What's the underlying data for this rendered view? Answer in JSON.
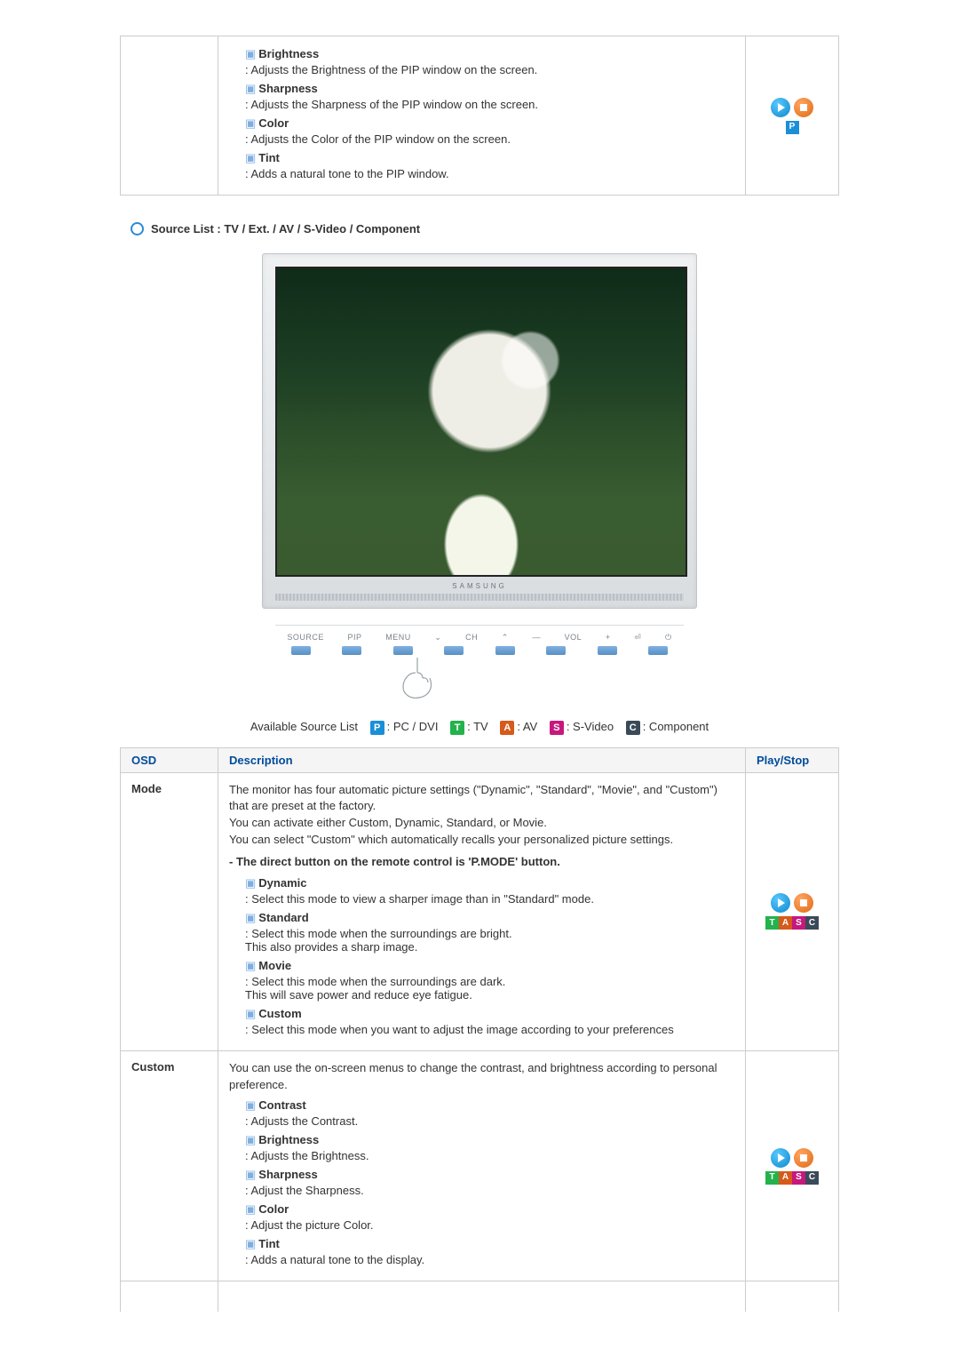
{
  "top_row": {
    "items": [
      {
        "title": "Brightness",
        "desc": ": Adjusts the Brightness of the PIP window on the screen."
      },
      {
        "title": "Sharpness",
        "desc": ": Adjusts the Sharpness of the PIP window on the screen."
      },
      {
        "title": "Color",
        "desc": ": Adjusts the Color of the PIP window on the screen."
      },
      {
        "title": "Tint",
        "desc": ": Adds a natural tone to the PIP window."
      }
    ],
    "play_labels": [
      "P"
    ]
  },
  "section_title": "Source List : TV / Ext. / AV / S-Video / Component",
  "monitor": {
    "brand": "SAMSUNG",
    "controls": [
      "SOURCE",
      "PIP",
      "MENU",
      "⌄",
      "CH",
      "⌃",
      "—",
      "VOL",
      "+",
      "⏎",
      "⏻"
    ]
  },
  "legend": {
    "prefix": "Available Source List",
    "items": [
      {
        "code": "P",
        "label": ": PC / DVI"
      },
      {
        "code": "T",
        "label": ": TV"
      },
      {
        "code": "A",
        "label": ": AV"
      },
      {
        "code": "S",
        "label": ": S-Video"
      },
      {
        "code": "C",
        "label": ": Component"
      }
    ]
  },
  "table": {
    "headers": {
      "osd": "OSD",
      "desc": "Description",
      "play": "Play/Stop"
    },
    "rows": [
      {
        "osd": "Mode",
        "intro": "The monitor has four automatic picture settings (\"Dynamic\", \"Standard\", \"Movie\", and \"Custom\") that are preset at the factory.\nYou can activate either Custom, Dynamic, Standard, or Movie.\nYou can select \"Custom\" which automatically recalls your personalized picture settings.",
        "bold_note": "- The direct button on the remote control is 'P.MODE' button.",
        "items": [
          {
            "title": "Dynamic",
            "desc": ": Select this mode to view a sharper image than in \"Standard\" mode."
          },
          {
            "title": "Standard",
            "desc": ": Select this mode when the surroundings are bright.\nThis also provides a sharp image."
          },
          {
            "title": "Movie",
            "desc": ": Select this mode when the surroundings are dark.\nThis will save power and reduce eye fatigue."
          },
          {
            "title": "Custom",
            "desc": ": Select this mode when you want to adjust the image according to your preferences"
          }
        ],
        "play_labels": [
          "T",
          "A",
          "S",
          "C"
        ]
      },
      {
        "osd": "Custom",
        "intro": "You can use the on-screen menus to change the contrast, and brightness according to personal preference.",
        "items": [
          {
            "title": "Contrast",
            "desc": ": Adjusts the Contrast."
          },
          {
            "title": "Brightness",
            "desc": ": Adjusts the Brightness."
          },
          {
            "title": "Sharpness",
            "desc": ": Adjust the Sharpness."
          },
          {
            "title": "Color",
            "desc": ": Adjust the picture Color."
          },
          {
            "title": "Tint",
            "desc": ": Adds a natural tone to the display."
          }
        ],
        "play_labels": [
          "T",
          "A",
          "S",
          "C"
        ]
      }
    ]
  }
}
